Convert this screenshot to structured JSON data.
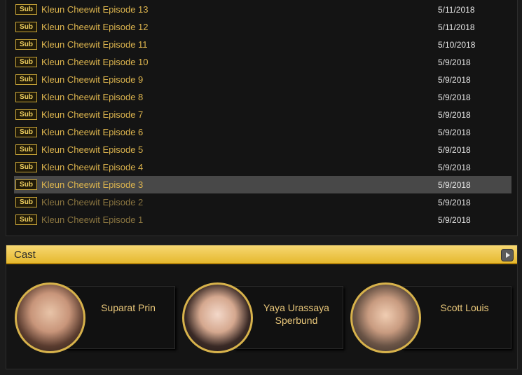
{
  "episodes": [
    {
      "badge": "Sub",
      "title": "Kleun Cheewit Episode 13",
      "date": "5/11/2018"
    },
    {
      "badge": "Sub",
      "title": "Kleun Cheewit Episode 12",
      "date": "5/11/2018"
    },
    {
      "badge": "Sub",
      "title": "Kleun Cheewit Episode 11",
      "date": "5/10/2018"
    },
    {
      "badge": "Sub",
      "title": "Kleun Cheewit Episode 10",
      "date": "5/9/2018"
    },
    {
      "badge": "Sub",
      "title": "Kleun Cheewit Episode 9",
      "date": "5/9/2018"
    },
    {
      "badge": "Sub",
      "title": "Kleun Cheewit Episode 8",
      "date": "5/9/2018"
    },
    {
      "badge": "Sub",
      "title": "Kleun Cheewit Episode 7",
      "date": "5/9/2018"
    },
    {
      "badge": "Sub",
      "title": "Kleun Cheewit Episode 6",
      "date": "5/9/2018"
    },
    {
      "badge": "Sub",
      "title": "Kleun Cheewit Episode 5",
      "date": "5/9/2018"
    },
    {
      "badge": "Sub",
      "title": "Kleun Cheewit Episode 4",
      "date": "5/9/2018"
    },
    {
      "badge": "Sub",
      "title": "Kleun Cheewit Episode 3",
      "date": "5/9/2018"
    },
    {
      "badge": "Sub",
      "title": "Kleun Cheewit Episode 2",
      "date": "5/9/2018"
    },
    {
      "badge": "Sub",
      "title": "Kleun Cheewit Episode 1",
      "date": "5/9/2018"
    }
  ],
  "cast": {
    "title": "Cast",
    "play_icon": "play-icon",
    "members": [
      {
        "name": "Suparat Prin",
        "photo_icon": "actor-photo"
      },
      {
        "name": "Yaya Urassaya Sperbund",
        "photo_icon": "actress-photo"
      },
      {
        "name": "Scott Louis",
        "photo_icon": "actor-photo"
      }
    ]
  },
  "colors": {
    "accent": "#dcb44e",
    "header_gold": "#f0c84a",
    "active_row": "#484848",
    "background": "#141414"
  }
}
